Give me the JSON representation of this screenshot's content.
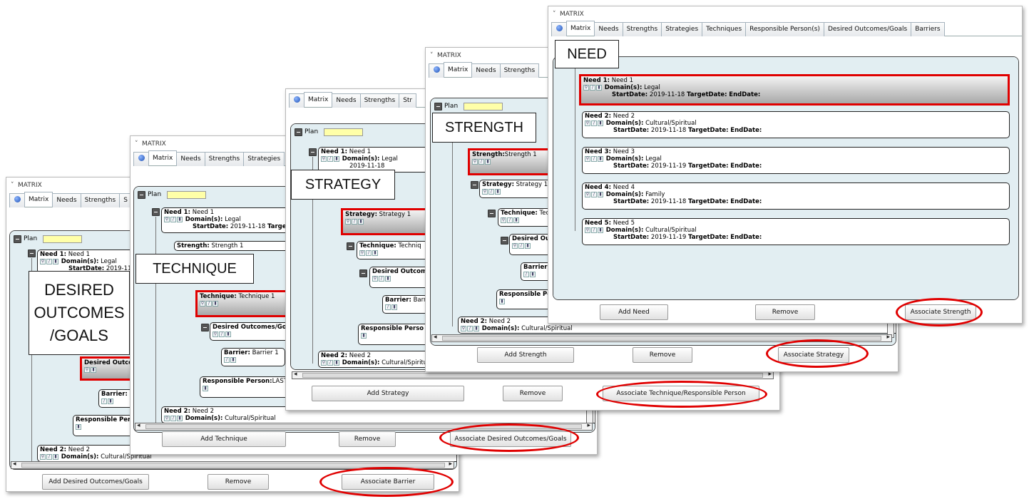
{
  "window_title": "MATRIX",
  "tabs_full": [
    "Matrix",
    "Needs",
    "Strengths",
    "Strategies",
    "Techniques",
    "Responsible Person(s)",
    "Desired Outcomes/Goals",
    "Barriers"
  ],
  "plan_label": "Plan",
  "callouts": {
    "need": "NEED",
    "strength": "STRENGTH",
    "strategy": "STRATEGY",
    "technique": "TECHNIQUE",
    "desired_line1": "DESIRED",
    "desired_line2": "OUTCOMES",
    "desired_line3": "/GOALS"
  },
  "buttons": {
    "add_need": "Add Need",
    "add_strength": "Add Strength",
    "add_strategy": "Add Strategy",
    "add_technique": "Add Technique",
    "add_desired": "Add Desired Outcomes/Goals",
    "remove": "Remove",
    "assoc_strength": "Associate Strength",
    "assoc_strategy": "Associate Strategy",
    "assoc_technique": "Associate Technique/Responsible Person",
    "assoc_desired": "Associate Desired Outcomes/Goals",
    "assoc_barrier": "Associate Barrier"
  },
  "labels": {
    "need_prefix": "Need 1:",
    "need2_prefix": "Need 2:",
    "domain": "Domain(s):",
    "start": "StartDate:",
    "target": "TargetDate:",
    "end": "EndDate:",
    "strength_prefix": "Strength:",
    "strategy_prefix": "Strategy:",
    "technique_prefix": "Technique:",
    "desired_prefix": "Desired Outcomes/Goals",
    "desired_short": "Desired Outco",
    "barrier_prefix": "Barrier:",
    "responsible_prefix": "Responsible Person:",
    "responsible_short": "Responsible Pers"
  },
  "needs": [
    {
      "label": "Need 1:",
      "name": "Need 1",
      "domain": "Legal",
      "start": "2019-11-18"
    },
    {
      "label": "Need 2:",
      "name": "Need 2",
      "domain": "Cultural/Spiritual",
      "start": "2019-11-18"
    },
    {
      "label": "Need 3:",
      "name": "Need 3",
      "domain": "Legal",
      "start": "2019-11-19"
    },
    {
      "label": "Need 4:",
      "name": "Need 4",
      "domain": "Family",
      "start": "2019-11-18"
    },
    {
      "label": "Need 5:",
      "name": "Need 5",
      "domain": "Cultural/Spiritual",
      "start": "2019-11-19"
    }
  ],
  "values": {
    "need1": "Need 1",
    "need2": "Need 2",
    "legal": "Legal",
    "cultural": "Cultural/Spiritual",
    "date1": "2019-11-18",
    "date1_short": "2019-11-1",
    "strength1": "Strength 1",
    "strategy1": "Strategy 1",
    "technique1": "Technique 1",
    "barrier1": "Barrier 1",
    "responsible_last": "LAST"
  }
}
